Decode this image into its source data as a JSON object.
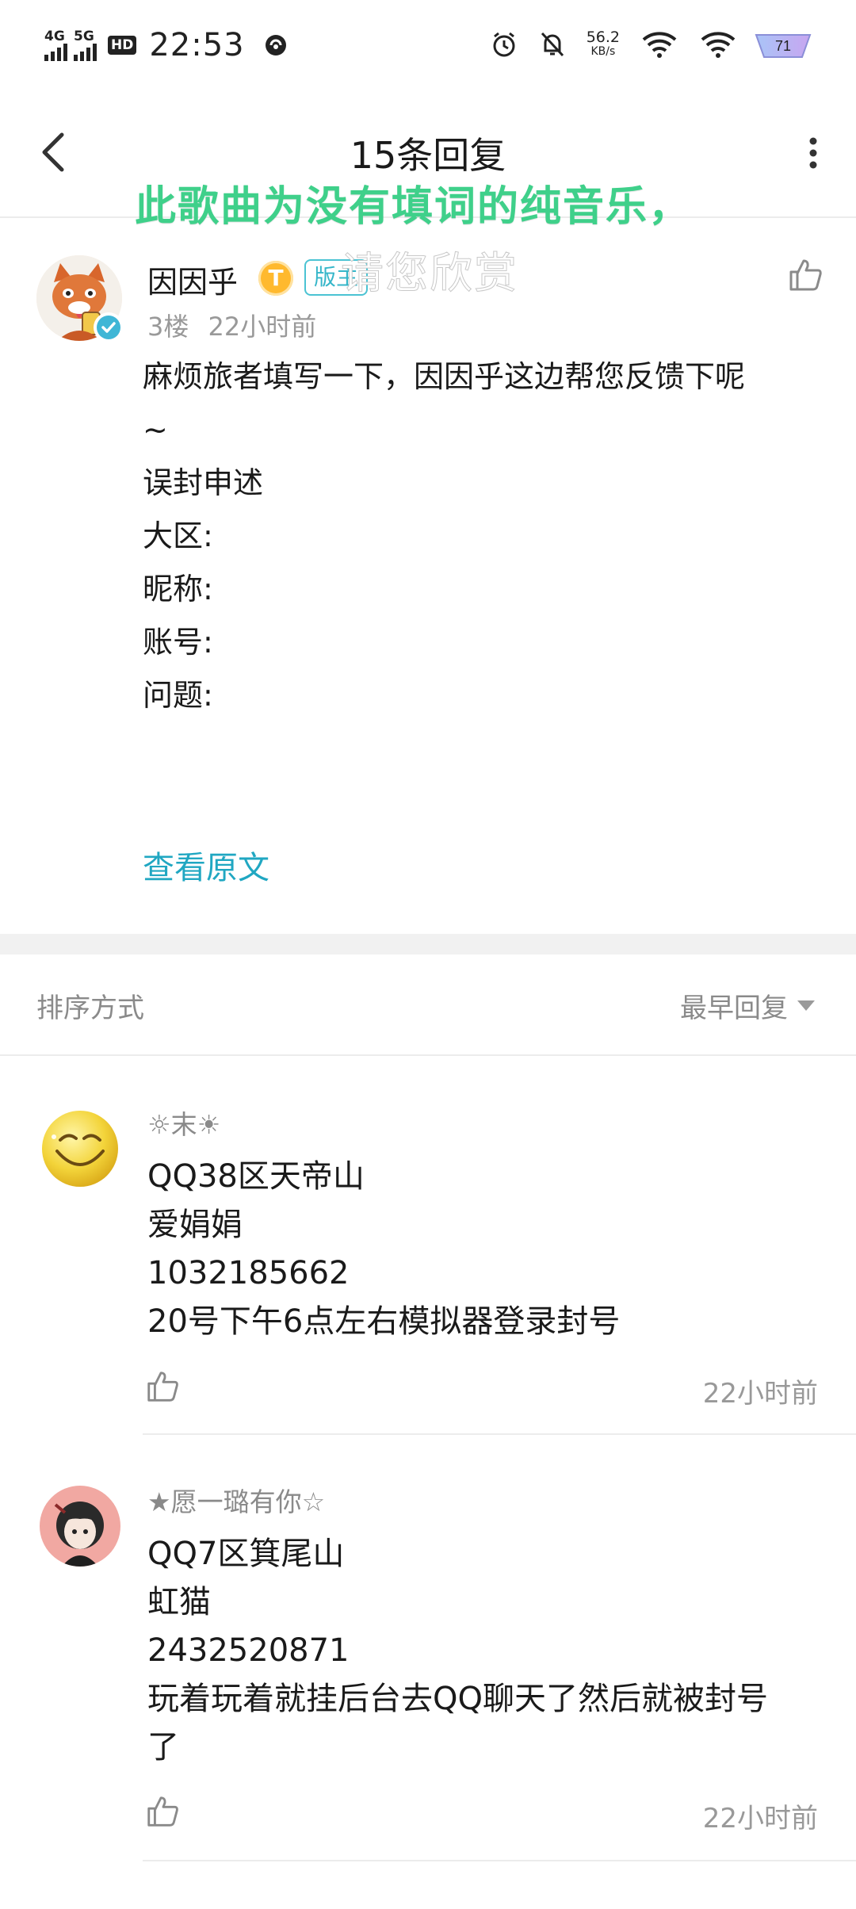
{
  "status_bar": {
    "sig1": "4G",
    "sig2": "5G",
    "hd": "HD",
    "hd_sub": "1\n2",
    "time": "22:53",
    "net_speed": "56.2",
    "net_unit": "KB/s",
    "battery": "71"
  },
  "nav": {
    "title": "15条回复"
  },
  "lyrics": {
    "line1": "此歌曲为没有填词的纯音乐，",
    "line2": "请您欣赏"
  },
  "post": {
    "author": "因因乎",
    "badge_t": "T",
    "badge_mod": "版主",
    "floor": "3楼",
    "time": "22小时前",
    "lines": [
      "麻烦旅者填写一下，因因乎这边帮您反馈下呢",
      "~",
      "误封申述",
      "大区:",
      "昵称:",
      "账号:",
      "问题:",
      ""
    ],
    "view_original": "查看原文"
  },
  "sort": {
    "label": "排序方式",
    "value": "最早回复"
  },
  "replies": [
    {
      "name": "☼末☀",
      "lines": [
        "QQ38区天帝山",
        "爱娟娟",
        "1032185662",
        "20号下午6点左右模拟器登录封号"
      ],
      "time": "22小时前"
    },
    {
      "name": "★愿一璐有你☆",
      "lines": [
        "QQ7区箕尾山",
        "虹猫",
        "2432520871",
        "玩着玩着就挂后台去QQ聊天了然后就被封号",
        "了"
      ],
      "time": "22小时前"
    }
  ],
  "colors": {
    "accent": "#20a7c2",
    "lyric_green": "#3fd08a",
    "meta_gray": "#999999"
  }
}
